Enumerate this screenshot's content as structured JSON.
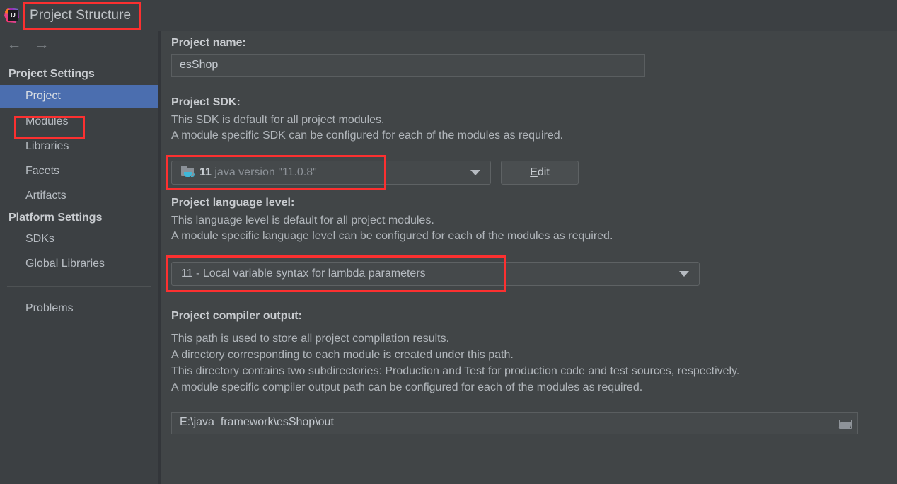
{
  "window": {
    "title": "Project Structure",
    "logo_icon": "intellij-idea-logo"
  },
  "nav": {
    "back_icon": "arrow-left-icon",
    "back_glyph": "←",
    "forward_icon": "arrow-right-icon",
    "forward_glyph": "→"
  },
  "sidebar": {
    "groups": [
      {
        "title": "Project Settings",
        "items": [
          {
            "label": "Project",
            "selected": true
          },
          {
            "label": "Modules",
            "selected": false
          },
          {
            "label": "Libraries",
            "selected": false
          },
          {
            "label": "Facets",
            "selected": false
          },
          {
            "label": "Artifacts",
            "selected": false
          }
        ]
      },
      {
        "title": "Platform Settings",
        "items": [
          {
            "label": "SDKs",
            "selected": false
          },
          {
            "label": "Global Libraries",
            "selected": false
          }
        ]
      }
    ],
    "problems_label": "Problems"
  },
  "main": {
    "project_name": {
      "label": "Project name:",
      "value": "esShop"
    },
    "project_sdk": {
      "label": "Project SDK:",
      "desc_line1": "This SDK is default for all project modules.",
      "desc_line2": "A module specific SDK can be configured for each of the modules as required.",
      "selected_version": "11",
      "selected_detail": "java version \"11.0.8\"",
      "icon": "java-sdk-folder-icon",
      "dropdown_icon": "chevron-down-icon",
      "edit_button": {
        "mnemonic": "E",
        "rest": "dit"
      }
    },
    "language_level": {
      "label": "Project language level:",
      "desc_line1": "This language level is default for all project modules.",
      "desc_line2": "A module specific language level can be configured for each of the modules as required.",
      "selected": "11 - Local variable syntax for lambda parameters",
      "dropdown_icon": "chevron-down-icon"
    },
    "compiler_output": {
      "label": "Project compiler output:",
      "desc_line1": "This path is used to store all project compilation results.",
      "desc_line2": "A directory corresponding to each module is created under this path.",
      "desc_line3": "This directory contains two subdirectories: Production and Test for production code and test sources, respectively.",
      "desc_line4": "A module specific compiler output path can be configured for each of the modules as required.",
      "path_value": "E:\\java_framework\\esShop\\out",
      "browse_icon": "open-folder-icon"
    }
  },
  "colors": {
    "background": "#414547",
    "sidebar_background": "#3c4043",
    "selection_blue": "#4b6eaf",
    "annotation_red": "#fc3030",
    "text_primary": "#c9ccd0",
    "text_secondary": "#b1b6bb",
    "sdk_icon_blue": "#3eb8d9"
  },
  "annotations": [
    {
      "target": "window-title"
    },
    {
      "target": "sidebar-item-project"
    },
    {
      "target": "project-sdk-combo"
    },
    {
      "target": "language-level-combo"
    }
  ]
}
